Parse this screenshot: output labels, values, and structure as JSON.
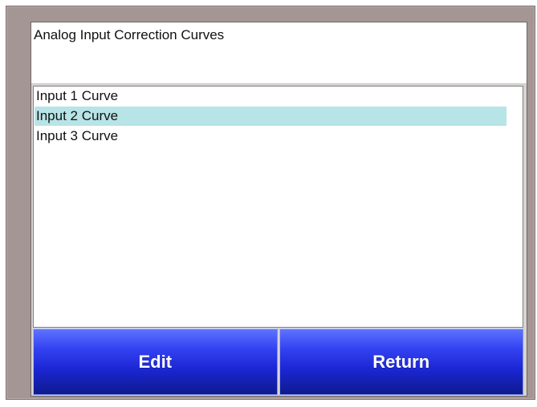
{
  "screen": {
    "title": "Analog Input Correction Curves"
  },
  "curves_list": {
    "items": [
      {
        "label": "Input 1 Curve",
        "selected": false
      },
      {
        "label": "Input 2 Curve",
        "selected": true
      },
      {
        "label": "Input 3 Curve",
        "selected": false
      }
    ]
  },
  "buttons": {
    "edit_label": "Edit",
    "return_label": "Return"
  },
  "colors": {
    "frame": "#a39695",
    "selection": "#b7e4e6",
    "button_top": "#5f73ff",
    "button_bottom": "#0f1a8d",
    "button_text": "#ffffff"
  }
}
